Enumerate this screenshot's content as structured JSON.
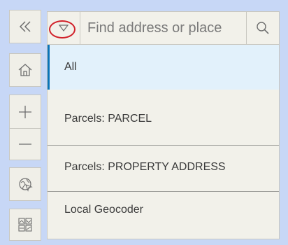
{
  "search": {
    "placeholder": "Find address or place"
  },
  "sources": [
    {
      "label": "All",
      "selected": true
    },
    {
      "label": "Parcels: PARCEL",
      "selected": false
    },
    {
      "label": "Parcels: PROPERTY ADDRESS",
      "selected": false
    },
    {
      "label": "Local Geocoder",
      "selected": false
    }
  ],
  "icons": {
    "collapse": "double-chevron-left-icon",
    "home": "home-icon",
    "zoom_in": "plus-icon",
    "zoom_out": "minus-icon",
    "locate": "locate-icon",
    "basemap": "basemap-gallery-icon",
    "source_toggle": "triangle-down-icon",
    "search": "search-icon"
  },
  "colors": {
    "background": "#c7d7f6",
    "panel": "#f2f1ea",
    "selected_row": "#e2f1fb",
    "accent": "#0a73b8",
    "highlight_circle": "#d1212a"
  }
}
